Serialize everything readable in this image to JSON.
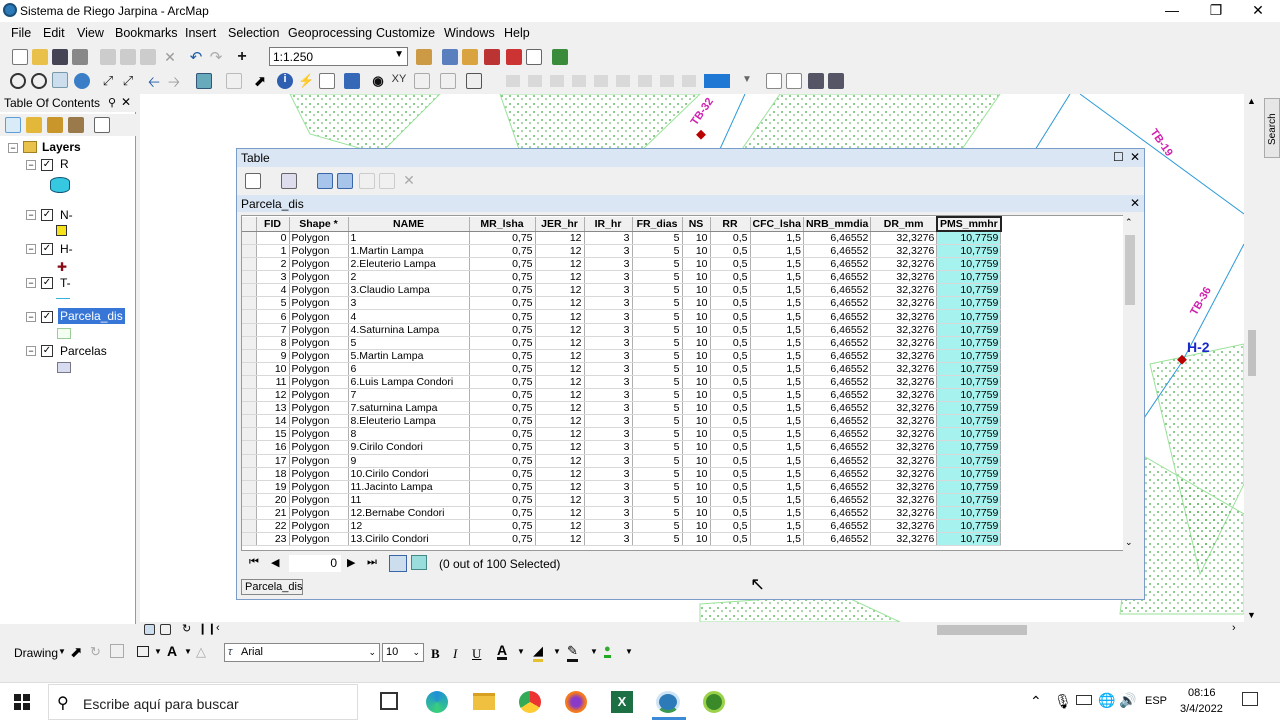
{
  "window": {
    "title": "Sistema de Riego Jarpina - ArcMap"
  },
  "menu": [
    "File",
    "Edit",
    "View",
    "Bookmarks",
    "Insert",
    "Selection",
    "Geoprocessing",
    "Customize",
    "Windows",
    "Help"
  ],
  "toolbar": {
    "scale": "1:1.250"
  },
  "toc": {
    "title": "Table Of Contents",
    "root": "Layers",
    "layers": [
      "R",
      "N-",
      "H-",
      "T-",
      "Parcela_dis",
      "Parcelas"
    ]
  },
  "map_labels": [
    "TB-32",
    "TB-19",
    "TB-36",
    "H-2"
  ],
  "table": {
    "window_title": "Table",
    "tab_title": "Parcela_dis",
    "columns": [
      "FID",
      "Shape *",
      "NAME",
      "MR_lsha",
      "JER_hr",
      "IR_hr",
      "FR_dias",
      "NS",
      "RR",
      "CFC_lsha",
      "NRB_mmdia",
      "DR_mm",
      "PMS_mmhr"
    ],
    "rows": [
      [
        "0",
        "Polygon",
        "1",
        "0,75",
        "12",
        "3",
        "5",
        "10",
        "0,5",
        "1,5",
        "6,46552",
        "32,3276",
        "10,7759"
      ],
      [
        "1",
        "Polygon",
        "1.Martin Lampa",
        "0,75",
        "12",
        "3",
        "5",
        "10",
        "0,5",
        "1,5",
        "6,46552",
        "32,3276",
        "10,7759"
      ],
      [
        "2",
        "Polygon",
        "2.Eleuterio Lampa",
        "0,75",
        "12",
        "3",
        "5",
        "10",
        "0,5",
        "1,5",
        "6,46552",
        "32,3276",
        "10,7759"
      ],
      [
        "3",
        "Polygon",
        "2",
        "0,75",
        "12",
        "3",
        "5",
        "10",
        "0,5",
        "1,5",
        "6,46552",
        "32,3276",
        "10,7759"
      ],
      [
        "4",
        "Polygon",
        "3.Claudio Lampa",
        "0,75",
        "12",
        "3",
        "5",
        "10",
        "0,5",
        "1,5",
        "6,46552",
        "32,3276",
        "10,7759"
      ],
      [
        "5",
        "Polygon",
        "3",
        "0,75",
        "12",
        "3",
        "5",
        "10",
        "0,5",
        "1,5",
        "6,46552",
        "32,3276",
        "10,7759"
      ],
      [
        "6",
        "Polygon",
        "4",
        "0,75",
        "12",
        "3",
        "5",
        "10",
        "0,5",
        "1,5",
        "6,46552",
        "32,3276",
        "10,7759"
      ],
      [
        "7",
        "Polygon",
        "4.Saturnina Lampa",
        "0,75",
        "12",
        "3",
        "5",
        "10",
        "0,5",
        "1,5",
        "6,46552",
        "32,3276",
        "10,7759"
      ],
      [
        "8",
        "Polygon",
        "5",
        "0,75",
        "12",
        "3",
        "5",
        "10",
        "0,5",
        "1,5",
        "6,46552",
        "32,3276",
        "10,7759"
      ],
      [
        "9",
        "Polygon",
        "5.Martin Lampa",
        "0,75",
        "12",
        "3",
        "5",
        "10",
        "0,5",
        "1,5",
        "6,46552",
        "32,3276",
        "10,7759"
      ],
      [
        "10",
        "Polygon",
        "6",
        "0,75",
        "12",
        "3",
        "5",
        "10",
        "0,5",
        "1,5",
        "6,46552",
        "32,3276",
        "10,7759"
      ],
      [
        "11",
        "Polygon",
        "6.Luis Lampa Condori",
        "0,75",
        "12",
        "3",
        "5",
        "10",
        "0,5",
        "1,5",
        "6,46552",
        "32,3276",
        "10,7759"
      ],
      [
        "12",
        "Polygon",
        "7",
        "0,75",
        "12",
        "3",
        "5",
        "10",
        "0,5",
        "1,5",
        "6,46552",
        "32,3276",
        "10,7759"
      ],
      [
        "13",
        "Polygon",
        "7.saturnina Lampa",
        "0,75",
        "12",
        "3",
        "5",
        "10",
        "0,5",
        "1,5",
        "6,46552",
        "32,3276",
        "10,7759"
      ],
      [
        "14",
        "Polygon",
        "8.Eleuterio Lampa",
        "0,75",
        "12",
        "3",
        "5",
        "10",
        "0,5",
        "1,5",
        "6,46552",
        "32,3276",
        "10,7759"
      ],
      [
        "15",
        "Polygon",
        "8",
        "0,75",
        "12",
        "3",
        "5",
        "10",
        "0,5",
        "1,5",
        "6,46552",
        "32,3276",
        "10,7759"
      ],
      [
        "16",
        "Polygon",
        "9.Cirilo Condori",
        "0,75",
        "12",
        "3",
        "5",
        "10",
        "0,5",
        "1,5",
        "6,46552",
        "32,3276",
        "10,7759"
      ],
      [
        "17",
        "Polygon",
        "9",
        "0,75",
        "12",
        "3",
        "5",
        "10",
        "0,5",
        "1,5",
        "6,46552",
        "32,3276",
        "10,7759"
      ],
      [
        "18",
        "Polygon",
        "10.Cirilo Condori",
        "0,75",
        "12",
        "3",
        "5",
        "10",
        "0,5",
        "1,5",
        "6,46552",
        "32,3276",
        "10,7759"
      ],
      [
        "19",
        "Polygon",
        "11.Jacinto Lampa",
        "0,75",
        "12",
        "3",
        "5",
        "10",
        "0,5",
        "1,5",
        "6,46552",
        "32,3276",
        "10,7759"
      ],
      [
        "20",
        "Polygon",
        "11",
        "0,75",
        "12",
        "3",
        "5",
        "10",
        "0,5",
        "1,5",
        "6,46552",
        "32,3276",
        "10,7759"
      ],
      [
        "21",
        "Polygon",
        "12.Bernabe Condori",
        "0,75",
        "12",
        "3",
        "5",
        "10",
        "0,5",
        "1,5",
        "6,46552",
        "32,3276",
        "10,7759"
      ],
      [
        "22",
        "Polygon",
        "12",
        "0,75",
        "12",
        "3",
        "5",
        "10",
        "0,5",
        "1,5",
        "6,46552",
        "32,3276",
        "10,7759"
      ],
      [
        "23",
        "Polygon",
        "13.Cirilo Condori",
        "0,75",
        "12",
        "3",
        "5",
        "10",
        "0,5",
        "1,5",
        "6,46552",
        "32,3276",
        "10,7759"
      ]
    ],
    "record": "0",
    "status": "(0 out of 100 Selected)",
    "bottom_tab": "Parcela_dis"
  },
  "drawing": {
    "label": "Drawing",
    "font": "Arial",
    "size": "10",
    "bold": "B",
    "italic": "I",
    "underline": "U"
  },
  "taskbar": {
    "search": "Escribe aquí para buscar",
    "lang": "ESP",
    "time": "08:16",
    "date": "3/4/2022"
  },
  "side_search": "Search"
}
